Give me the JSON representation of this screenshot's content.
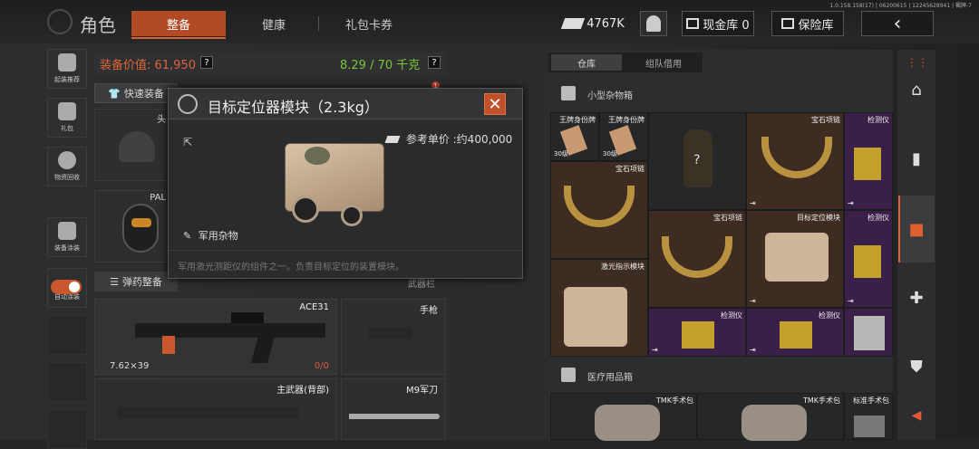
{
  "app": {
    "title": "角色",
    "version": "1.0.158.158(17) | 06200615 | 12245628941 | 楓牌-7"
  },
  "tabs": [
    {
      "label": "整备"
    },
    {
      "label": "健康"
    },
    {
      "label": "礼包卡券"
    }
  ],
  "topbar": {
    "coins": "4767K",
    "cash_label": "现金库 0",
    "safe_label": "保险库",
    "back_icon": "‹"
  },
  "sidebar": [
    {
      "label": "起装推荐",
      "icon": "loadout-icon"
    },
    {
      "label": "礼包",
      "icon": "gift-icon"
    },
    {
      "label": "物资回收",
      "icon": "recycle-icon"
    },
    {
      "label": "装备涂装",
      "icon": "paint-icon"
    },
    {
      "label": "自动涂装",
      "icon": "toggle-icon"
    }
  ],
  "equipment": {
    "value_label": "装备价值: 61,950",
    "weight_label": "8.29 / 70 千克",
    "quick_label": "快速装备",
    "head_label": "头",
    "face_label": "PAL",
    "ammo_label": "弹药整备",
    "weaponbar_label": "武器栏",
    "ace": {
      "name": "ACE31",
      "caliber": "7.62×39",
      "ammo": "0/0"
    },
    "pistol_label": "手枪",
    "primary2_label": "主武器(背部)",
    "knife_label": "M9军刀",
    "badge": "1"
  },
  "popup": {
    "title": "目标定位器模块（2.3kg）",
    "close": "✕",
    "share": "⇱",
    "price": "参考单价 :约400,000",
    "category": "军用杂物",
    "description": "军用激光测距仪的组件之一。负责目标定位的装置模块。"
  },
  "storage": {
    "tabs": [
      "仓库",
      "组队借用"
    ],
    "sections": [
      {
        "title": "小型杂物箱"
      },
      {
        "title": "医疗用品箱"
      }
    ],
    "cells": [
      {
        "name": "王牌身份牌",
        "sub": "30级"
      },
      {
        "name": "王牌身份牌",
        "sub": "30级"
      },
      {
        "name": "?",
        "sub": ""
      },
      {
        "name": "宝石项链",
        "sub": ""
      },
      {
        "name": "检测仪",
        "sub": ""
      },
      {
        "name": "宝石项链",
        "sub": ""
      },
      {
        "name": "宝石项链",
        "sub": ""
      },
      {
        "name": "目标定位模块",
        "sub": ""
      },
      {
        "name": "检测仪",
        "sub": ""
      },
      {
        "name": "激光指示模块",
        "sub": ""
      },
      {
        "name": "检测仪",
        "sub": ""
      },
      {
        "name": "检测仪",
        "sub": ""
      },
      {
        "name": "",
        "sub": ""
      }
    ],
    "med_cells": [
      {
        "name": "TMK手术包"
      },
      {
        "name": "TMK手术包"
      },
      {
        "name": "标准手术包"
      }
    ],
    "exit_icon": "⇥"
  },
  "rightnav": [
    {
      "icon": "home-icon",
      "glyph": "⌂"
    },
    {
      "icon": "magazine-icon",
      "glyph": "▮"
    },
    {
      "icon": "box-icon",
      "glyph": "■"
    },
    {
      "icon": "medkit-icon",
      "glyph": "✚"
    },
    {
      "icon": "armor-icon",
      "glyph": "⛊"
    },
    {
      "icon": "collapse-icon",
      "glyph": "◀"
    }
  ]
}
